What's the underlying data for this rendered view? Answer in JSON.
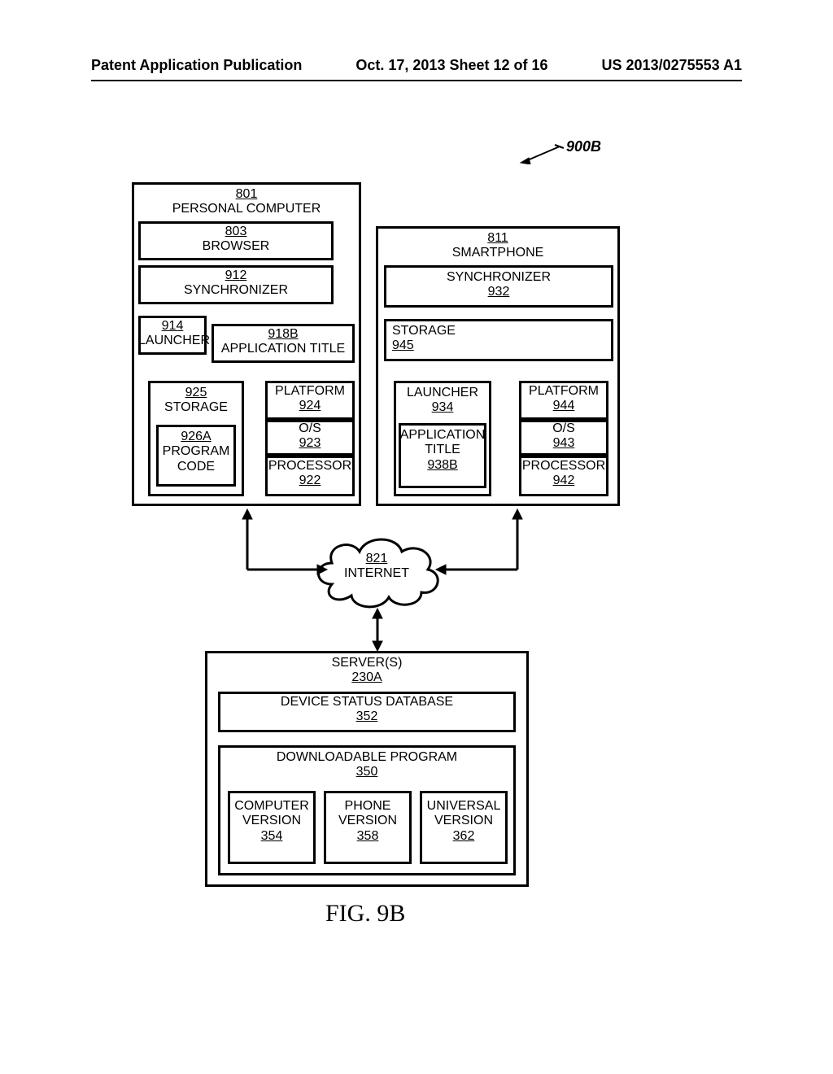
{
  "header": {
    "left": "Patent Application Publication",
    "mid": "Oct. 17, 2013   Sheet 12 of 16",
    "right": "US 2013/0275553 A1"
  },
  "ref": {
    "num": "900B"
  },
  "pc": {
    "num": "801",
    "label": "PERSONAL COMPUTER",
    "browser": {
      "num": "803",
      "label": "BROWSER"
    },
    "sync": {
      "num": "912",
      "label": "SYNCHRONIZER"
    },
    "launcher": {
      "num": "914",
      "label": "LAUNCHER"
    },
    "apptitle": {
      "num": "918B",
      "label": "APPLICATION TITLE"
    },
    "storage": {
      "num": "925",
      "label": "STORAGE"
    },
    "progcode": {
      "num": "926A",
      "label1": "PROGRAM",
      "label2": "CODE"
    },
    "platform": {
      "num": "924",
      "label": "PLATFORM"
    },
    "os": {
      "num": "923",
      "label": "O/S"
    },
    "proc": {
      "num": "922",
      "label": "PROCESSOR"
    }
  },
  "phone": {
    "num": "811",
    "label": "SMARTPHONE",
    "sync": {
      "num": "932",
      "label": "SYNCHRONIZER"
    },
    "storage": {
      "num": "945",
      "label": "STORAGE"
    },
    "launcher": {
      "num": "934",
      "label": "LAUNCHER"
    },
    "apptitle": {
      "num": "938B",
      "label1": "APPLICATION",
      "label2": "TITLE"
    },
    "platform": {
      "num": "944",
      "label": "PLATFORM"
    },
    "os": {
      "num": "943",
      "label": "O/S"
    },
    "proc": {
      "num": "942",
      "label": "PROCESSOR"
    }
  },
  "cloud": {
    "num": "821",
    "label": "INTERNET"
  },
  "server": {
    "label": "SERVER(S)",
    "num": "230A",
    "db": {
      "label": "DEVICE STATUS DATABASE",
      "num": "352"
    },
    "dl": {
      "label": "DOWNLOADABLE PROGRAM",
      "num": "350"
    },
    "v1": {
      "label1": "COMPUTER",
      "label2": "VERSION",
      "num": "354"
    },
    "v2": {
      "label1": "PHONE",
      "label2": "VERSION",
      "num": "358"
    },
    "v3": {
      "label1": "UNIVERSAL",
      "label2": "VERSION",
      "num": "362"
    }
  },
  "figure": {
    "caption": "FIG. 9B"
  }
}
